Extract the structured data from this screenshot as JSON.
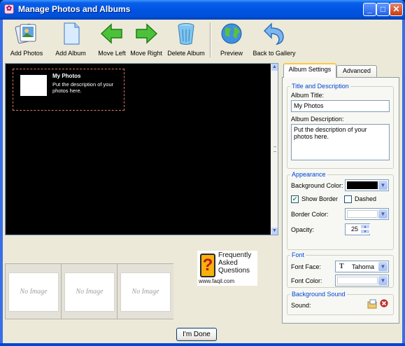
{
  "window": {
    "title": "Manage Photos and Albums",
    "min_glyph": "_",
    "max_glyph": "□",
    "close_glyph": "✕"
  },
  "toolbar": {
    "add_photos": "Add Photos",
    "add_album": "Add Album",
    "move_left": "Move Left",
    "move_right": "Move Right",
    "delete_album": "Delete Album",
    "preview": "Preview",
    "back_to_gallery": "Back to Gallery"
  },
  "album": {
    "name": "My Photos",
    "description": "Put the description of your photos here."
  },
  "thumbnails": [
    "No Image",
    "No Image",
    "No Image"
  ],
  "watermark": {
    "line1": "Frequently",
    "line2": "Asked",
    "line3": "Questions",
    "url": "www.faqil.com",
    "q": "?"
  },
  "done_button": "I'm Done",
  "tabs": {
    "album_settings": "Album Settings",
    "advanced": "Advanced"
  },
  "title_desc": {
    "group": "Title and Description",
    "album_title_label": "Album Title:",
    "album_title_value": "My Photos",
    "album_desc_label": "Album Description:",
    "album_desc_value": "Put the description of your photos here."
  },
  "appearance": {
    "group": "Appearance",
    "bg_color_label": "Background Color:",
    "bg_color": "#000000",
    "show_border": "Show Border",
    "show_border_checked": "✔",
    "dashed": "Dashed",
    "border_color_label": "Border Color:",
    "border_color": "#ffffff",
    "opacity_label": "Opacity:",
    "opacity_value": "25"
  },
  "font": {
    "group": "Font",
    "face_label": "Font Face:",
    "face_value": "Tahoma",
    "face_glyph": "T",
    "color_label": "Font Color:",
    "color": "#ffffff"
  },
  "sound": {
    "group": "Background Sound",
    "label": "Sound:"
  },
  "colors": {
    "accent": "#0054e3",
    "group_title": "#0046d5",
    "tab_highlight": "#ffc83c"
  }
}
